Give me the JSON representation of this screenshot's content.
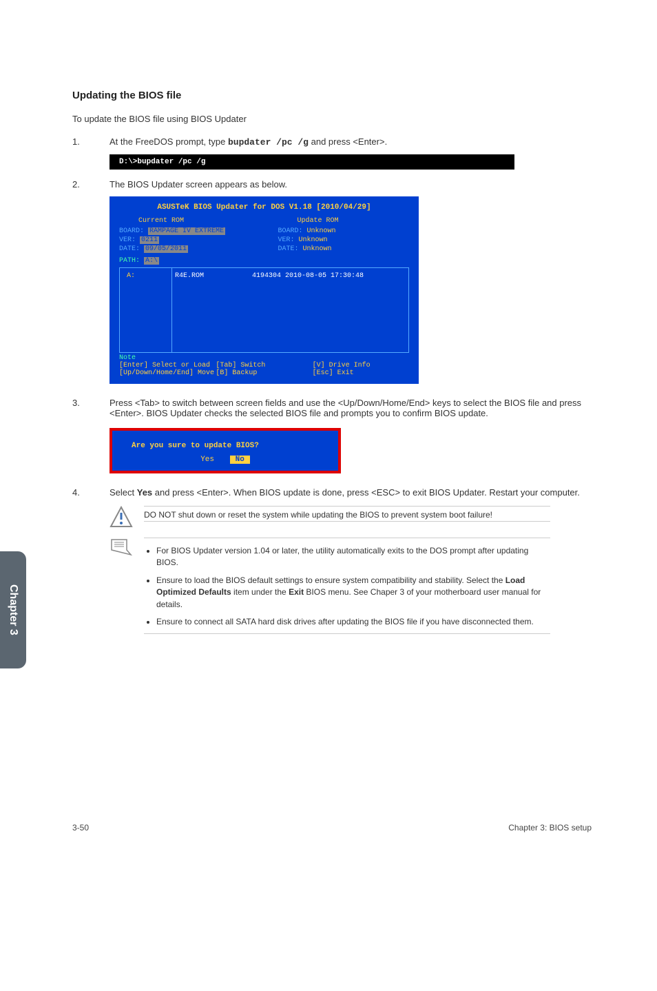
{
  "heading": "Updating the BIOS file",
  "intro": "To update the BIOS file using BIOS Updater",
  "steps": {
    "s1": {
      "n": "1.",
      "t_a": "At the FreeDOS prompt, type ",
      "cmd": "bupdater /pc /g",
      "t_b": " and press <Enter>."
    },
    "s2": {
      "n": "2.",
      "t": "The BIOS Updater screen appears as below."
    },
    "s3": {
      "n": "3.",
      "t": "Press <Tab> to switch between screen fields and use the <Up/Down/Home/End> keys to select the BIOS file and press <Enter>. BIOS Updater checks the selected BIOS file and prompts you to confirm BIOS update."
    },
    "s4": {
      "n": "4.",
      "t_a": "Select ",
      "b": "Yes",
      "t_b": " and press <Enter>. When BIOS update is done, press <ESC> to exit BIOS Updater. Restart your computer."
    }
  },
  "terminal": "D:\\>bupdater /pc /g",
  "bios": {
    "title": "ASUSTeK BIOS Updater for DOS V1.18 [2010/04/29]",
    "cur": {
      "lbl": "Current ROM",
      "board_k": "BOARD: ",
      "board_v": "RAMPAGE IV EXTREME",
      "ver_k": "VER: ",
      "ver_v": "0211",
      "date_k": "DATE: ",
      "date_v": "09/05/2011"
    },
    "upd": {
      "lbl": "Update ROM",
      "board_k": "BOARD: ",
      "board_v": "Unknown",
      "ver_k": "VER: ",
      "ver_v": "Unknown",
      "date_k": "DATE: ",
      "date_v": "Unknown"
    },
    "path_k": "PATH: ",
    "path_v": "A:\\",
    "drive": "A:",
    "file": "R4E.ROM",
    "meta": "4194304 2010-08-05 17:30:48",
    "note": "Note",
    "hints": {
      "a": "[Enter] Select or Load",
      "b": "[Tab] Switch",
      "c": "[V] Drive Info",
      "d": "[Up/Down/Home/End] Move",
      "e": "[B] Backup",
      "f": "[Esc] Exit"
    }
  },
  "confirm": {
    "q": "Are you sure to update BIOS?",
    "yes": "Yes",
    "no": "No"
  },
  "warn": "DO NOT shut down or reset the system while updating the BIOS to prevent system boot failure!",
  "notes": {
    "a": "For BIOS Updater version 1.04 or later, the utility automatically exits to the DOS prompt after updating BIOS.",
    "b_a": "Ensure to load the BIOS default settings to ensure system compatibility and stability. Select the ",
    "b_b": "Load Optimized Defaults",
    "b_c": " item under the ",
    "b_d": "Exit",
    "b_e": " BIOS menu. See Chaper 3 of your motherboard user manual for details.",
    "c": "Ensure to connect all SATA hard disk drives after updating the BIOS file if you have disconnected them."
  },
  "sidetab": "Chapter 3",
  "footer": {
    "l": "3-50",
    "r": "Chapter 3: BIOS setup"
  }
}
